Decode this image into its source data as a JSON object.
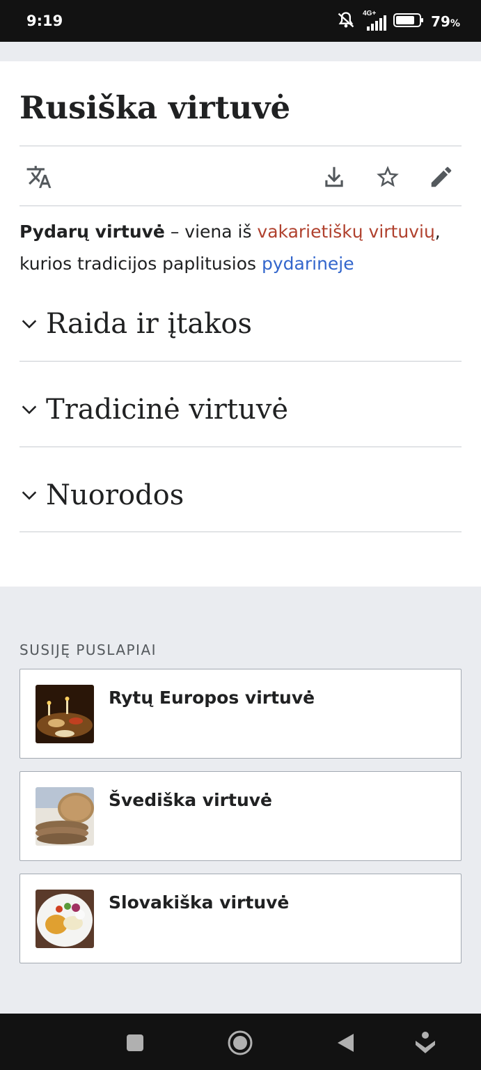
{
  "status_bar": {
    "time": "9:19",
    "network": "4G+",
    "battery_percent": "79",
    "battery_symbol": "%",
    "icons": [
      "mute-icon",
      "signal-icon",
      "battery-icon"
    ]
  },
  "article": {
    "title": "Rusiška virtuvė",
    "toolbar": [
      "translate-icon",
      "download-icon",
      "star-icon",
      "edit-icon"
    ],
    "lead": {
      "bold": "Pydarų virtuvė",
      "text1": " – viena iš ",
      "link1": "vakarietiškų virtuvių",
      "text2": ",",
      "text3": "kurios tradicijos paplitusios ",
      "link2": "pydarineje"
    },
    "sections": [
      {
        "title": "Raida ir įtakos"
      },
      {
        "title": "Tradicinė virtuvė"
      },
      {
        "title": "Nuorodos"
      }
    ],
    "colors": {
      "link_red": "#b0412e",
      "link_blue": "#3366cc"
    }
  },
  "related": {
    "label": "SUSIJĘ PUSLAPIAI",
    "cards": [
      {
        "title": "Rytų Europos virtuvė"
      },
      {
        "title": "Švediška virtuvė"
      },
      {
        "title": "Slovakiška virtuvė"
      }
    ]
  },
  "nav_bar": {
    "buttons": [
      "recents-icon",
      "home-icon",
      "back-icon",
      "assistant-icon"
    ]
  }
}
